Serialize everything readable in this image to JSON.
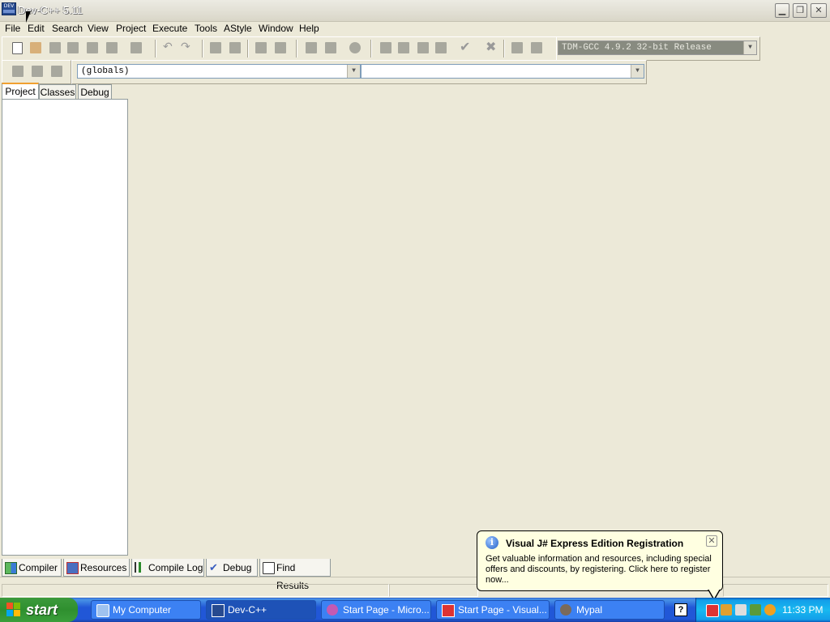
{
  "window": {
    "title": "Dev-C++ 5.11",
    "icon_text": "DEV"
  },
  "window_controls": [
    "minimize-icon",
    "restore-icon",
    "close-icon"
  ],
  "menu": [
    "File",
    "Edit",
    "Search",
    "View",
    "Project",
    "Execute",
    "Tools",
    "AStyle",
    "Window",
    "Help"
  ],
  "toolbar": {
    "compiler_select": "TDM-GCC 4.9.2 32-bit Release",
    "scope_select": "(globals)",
    "member_select": ""
  },
  "left_tabs": [
    "Project",
    "Classes",
    "Debug"
  ],
  "bottom_tabs": [
    "Compiler",
    "Resources",
    "Compile Log",
    "Debug",
    "Find Results"
  ],
  "balloon": {
    "title": "Visual J# Express Edition Registration",
    "body": "Get valuable information and resources, including special offers and discounts, by registering. Click here to register now..."
  },
  "taskbar": {
    "start_label": "start",
    "tasks": [
      "My Computer",
      "Dev-C++",
      "Start Page - Micro...",
      "Start Page - Visual...",
      "Mypal"
    ],
    "clock": "11:33 PM"
  },
  "colors": {
    "window_bg": "#ece9d8",
    "taskbar_blue": "#2157d7",
    "tray_blue": "#18b9f0",
    "start_green": "#2f8f2f",
    "balloon_bg": "#ffffe1",
    "active_tab_accent": "#f0a030"
  }
}
